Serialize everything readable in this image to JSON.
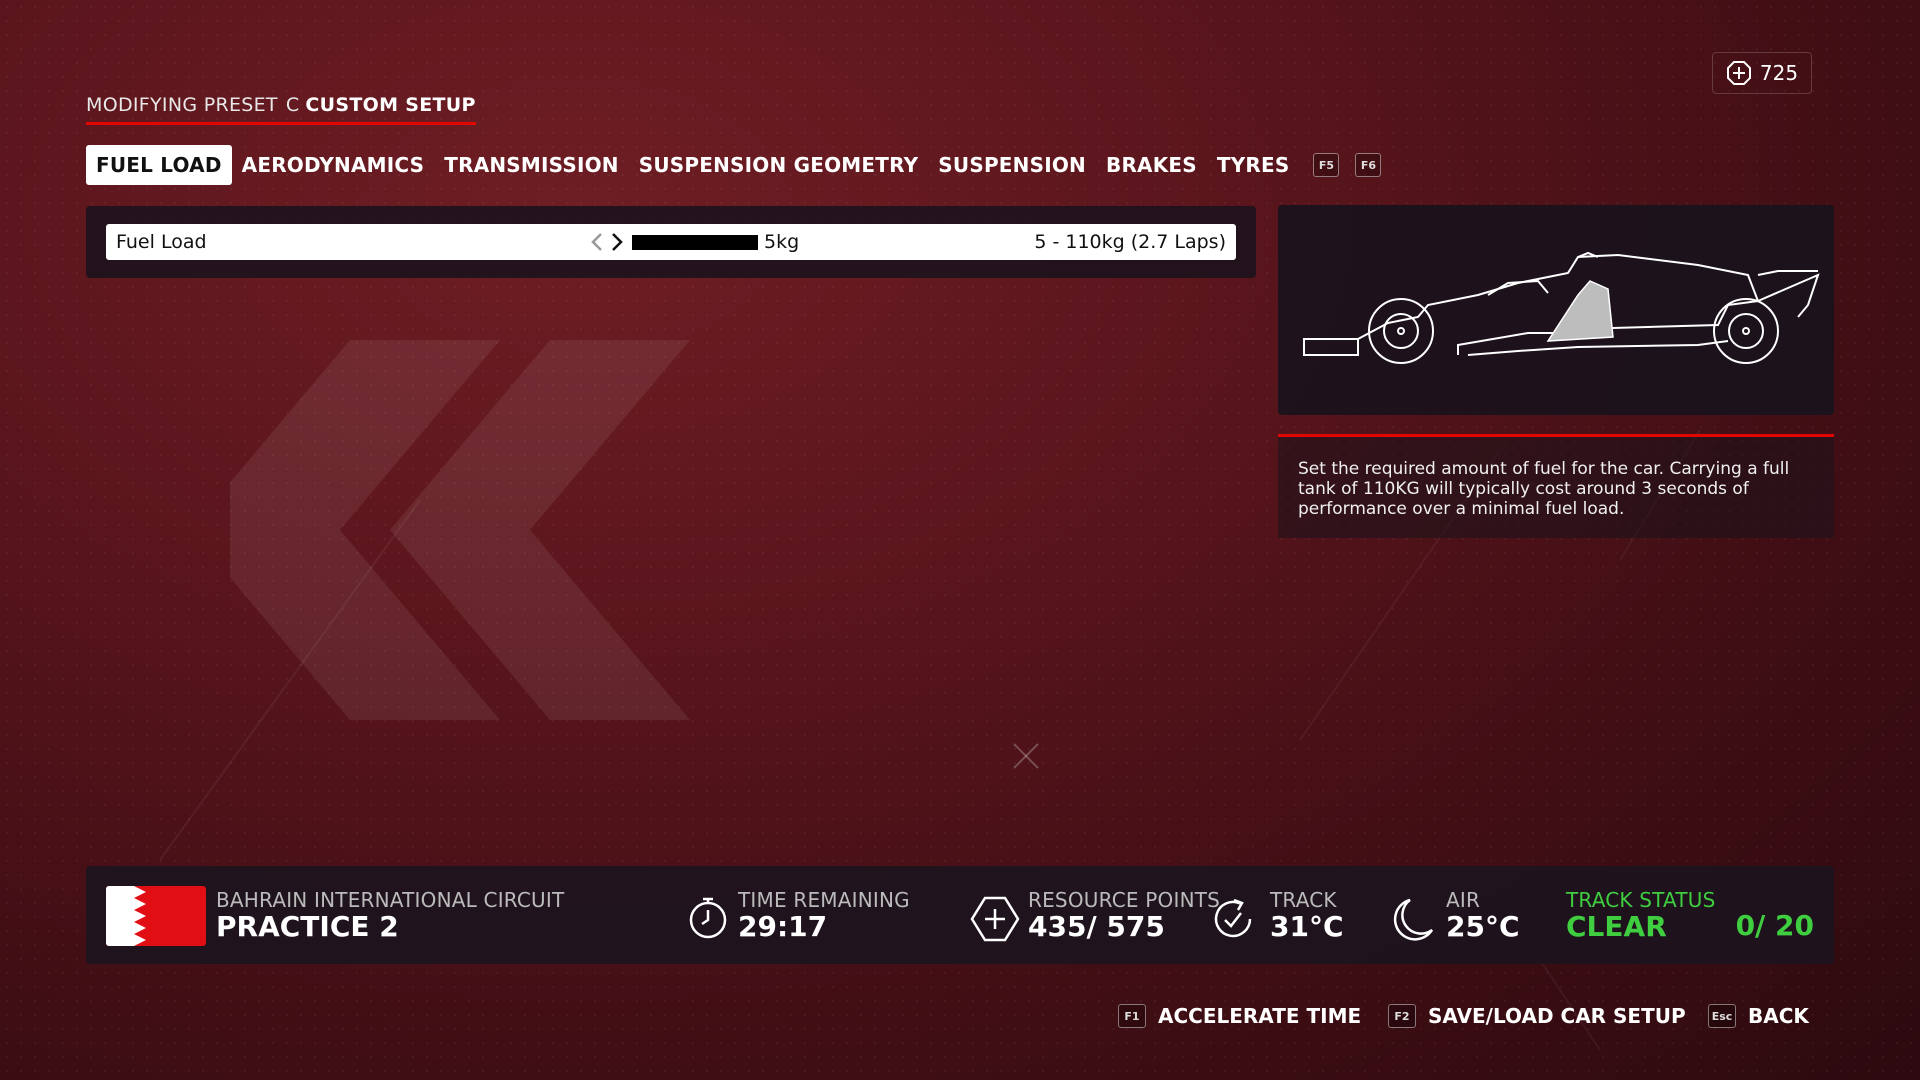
{
  "header": {
    "preset_prefix": "MODIFYING PRESET",
    "preset_letter": "C",
    "preset_name": "CUSTOM SETUP",
    "resource_count": "725"
  },
  "tabs": [
    {
      "label": "FUEL LOAD",
      "active": true
    },
    {
      "label": "AERODYNAMICS"
    },
    {
      "label": "TRANSMISSION"
    },
    {
      "label": "SUSPENSION GEOMETRY"
    },
    {
      "label": "SUSPENSION"
    },
    {
      "label": "BRAKES"
    },
    {
      "label": "TYRES"
    }
  ],
  "tab_keys": {
    "prev": "F5",
    "next": "F6"
  },
  "setting": {
    "label": "Fuel Load",
    "value": "5kg",
    "range": "5 - 110kg (2.7 Laps)",
    "level_fraction": 0.0
  },
  "description": "Set the required amount of fuel for the car. Carrying a full tank of 110KG will typically cost around 3 seconds of performance over a minimal fuel load.",
  "info_bar": {
    "circuit": "BAHRAIN INTERNATIONAL CIRCUIT",
    "session": "PRACTICE 2",
    "time_label": "TIME REMAINING",
    "time_value": "29:17",
    "resource_label": "RESOURCE POINTS",
    "resource_value": "435/ 575",
    "track_label": "TRACK",
    "track_value": "31°C",
    "air_label": "AIR",
    "air_value": "25°C",
    "status_label": "TRACK STATUS",
    "status_value": "CLEAR",
    "status_count": "0/ 20",
    "status_color": "#3fce3f",
    "flag_colors": {
      "red": "#e10f14",
      "white": "#ffffff"
    }
  },
  "footer": [
    {
      "key": "F1",
      "label": "ACCELERATE TIME"
    },
    {
      "key": "F2",
      "label": "SAVE/LOAD CAR SETUP"
    },
    {
      "key": "Esc",
      "label": "BACK"
    }
  ],
  "colors": {
    "accent": "#e10600",
    "panel": "#19121c"
  }
}
